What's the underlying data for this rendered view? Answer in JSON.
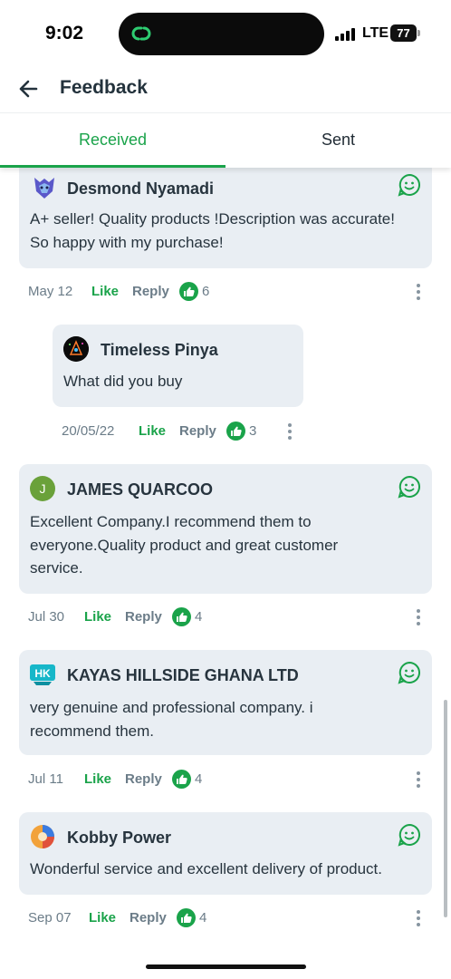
{
  "status_bar": {
    "time": "9:02",
    "network": "LTE",
    "battery": "77",
    "icons": [
      "link-icon",
      "signal-icon",
      "battery-icon"
    ]
  },
  "header": {
    "title": "Feedback",
    "back_icon": "arrow-left-icon"
  },
  "tabs": {
    "received": "Received",
    "sent": "Sent",
    "active": "received"
  },
  "colors": {
    "accent": "#1aa34a",
    "card": "#e9eef3",
    "muted": "#6b7c88",
    "text": "#27343e"
  },
  "feed": [
    {
      "author": "Desmond Nyamadi",
      "text": "A+ seller! Quality products !Description was accurate! So happy with my purchase!",
      "date": "May 12",
      "like": "Like",
      "reply": "Reply",
      "count": "6"
    },
    {
      "author": "Timeless Pinya",
      "text": "What did you buy",
      "date": "20/05/22",
      "like": "Like",
      "reply": "Reply",
      "count": "3"
    },
    {
      "author": "JAMES QUARCOO",
      "avatar_letter": "J",
      "text": "Excellent Company.I recommend them to everyone.Quality product and great customer service.",
      "date": "Jul 30",
      "like": "Like",
      "reply": "Reply",
      "count": "4"
    },
    {
      "author": "KAYAS HILLSIDE GHANA LTD",
      "text": "very genuine and professional company. i recommend them.",
      "date": "Jul 11",
      "like": "Like",
      "reply": "Reply",
      "count": "4"
    },
    {
      "author": "Kobby Power",
      "text": "Wonderful service and excellent delivery of product.",
      "date": "Sep 07",
      "like": "Like",
      "reply": "Reply",
      "count": "4"
    }
  ]
}
